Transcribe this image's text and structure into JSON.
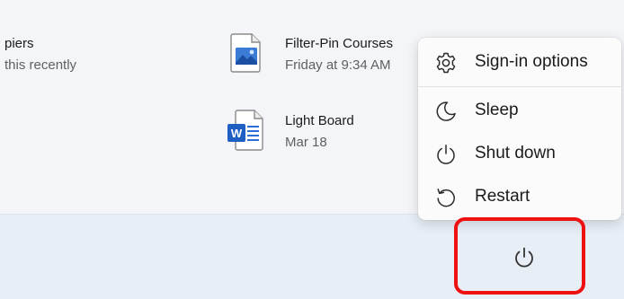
{
  "recommended": [
    {
      "name": "piers",
      "subtitle": "this recently",
      "icon": "file-icon"
    },
    {
      "name": "Filter-Pin Courses",
      "subtitle": "Friday at 9:34 AM",
      "icon": "image-file-icon"
    },
    {
      "name": "Light Board",
      "subtitle": "Mar 18",
      "icon": "word-document-icon"
    }
  ],
  "power_menu": {
    "items": [
      {
        "label": "Sign-in options",
        "icon": "gear-icon"
      },
      {
        "label": "Sleep",
        "icon": "moon-icon"
      },
      {
        "label": "Shut down",
        "icon": "power-icon"
      },
      {
        "label": "Restart",
        "icon": "restart-icon"
      }
    ]
  },
  "power_button": {
    "icon": "power-icon"
  },
  "colors": {
    "highlight": "#ee1111",
    "word_blue": "#1f5fc4",
    "image_blue": "#3a7bd5"
  }
}
